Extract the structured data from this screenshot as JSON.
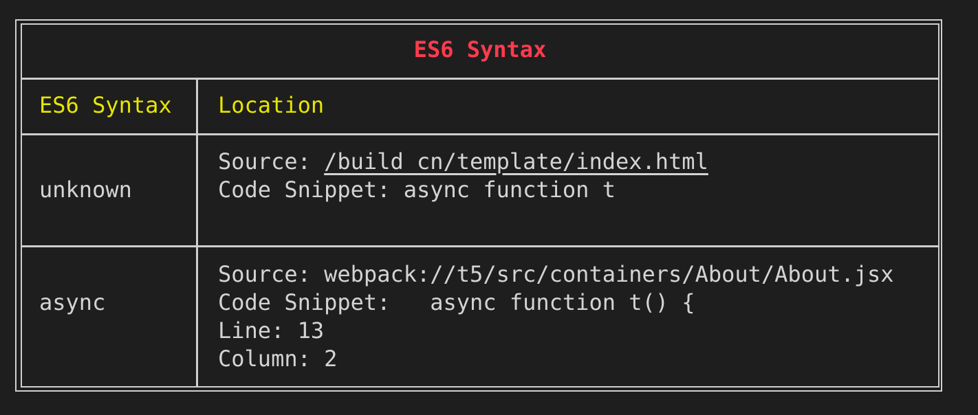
{
  "table": {
    "title": "ES6 Syntax",
    "headers": [
      "ES6 Syntax",
      "Location"
    ],
    "rows": [
      {
        "syntax": "unknown",
        "source_label": "Source: ",
        "source_path": "/build_cn/template/index.html",
        "snippet": "Code Snippet: async function t"
      },
      {
        "syntax": "async",
        "source_label": "Source: ",
        "source_path": "webpack://t5/src/containers/About/About.jsx",
        "snippet": "Code Snippet:   async function t() {",
        "line": "Line: 13",
        "column": "Column: 2"
      }
    ]
  },
  "colors": {
    "title": "#ff3b4e",
    "header": "#e6e600",
    "text": "#d4d4d4",
    "border": "#cfcfcf",
    "background": "#1e1e1e"
  }
}
